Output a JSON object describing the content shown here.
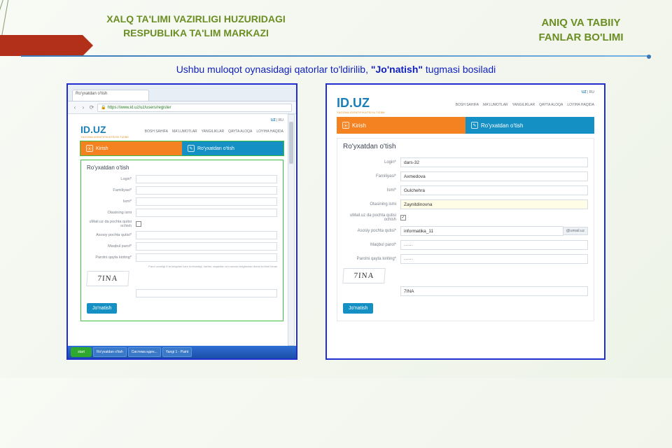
{
  "header": {
    "left_line1": "XALQ TA'LIMI VAZIRLIGI HUZURIDAGI",
    "left_line2": "RESPUBLIKA TA'LIM MARKAZI",
    "right_line1": "ANIQ VA TABIIY",
    "right_line2": "FANLAR BO'LIMI"
  },
  "subtitle": {
    "part1": "Ushbu muloqot oynasidagi qatorlar to'ldirilib, ",
    "part2": "\"Jo'natish\"",
    "part3": "  tugmasi bosiladi"
  },
  "browser": {
    "tab_title": "Ro'yxatdan o'tish",
    "url": "https://www.id.uz/uz/users/register"
  },
  "site": {
    "brand": "ID.UZ",
    "brand_sub": "YAGONA IDENTIFIKATSIYA TIZIMI",
    "lang_active": "UZ",
    "lang_other": "RU",
    "nav": [
      "BOSH SAHIFA",
      "MA'LUMOTLAR",
      "YANGILIKLAR",
      "QAYTA ALOQA",
      "LOYIHA HAQIDA"
    ],
    "tab_login": "Kirish",
    "tab_register": "Ro'yxatdan o'tish",
    "form_title": "Ro'yxatdan o'tish"
  },
  "formA": {
    "labels": {
      "login": "Login*",
      "familiya": "Familiyasi*",
      "ismi": "Ismi*",
      "otasi": "Otasining ismi",
      "umail_chk": "uMail.uz da pochta qutisi ochish",
      "asosiy": "Asosiy pochta qutisi*",
      "parol": "Maqbul parol*",
      "parol2": "Parolni qayta kiriting*"
    },
    "hint": "Parol uzunligi 8 ta belgidan kam bo'lmasligi, harflar, raqamlar va maxsus belgilardan iborat bo'lishi kerak",
    "captcha": "7INA",
    "submit": "Jo'natish"
  },
  "formB": {
    "values": {
      "login": "dars-32",
      "familiya": "Axmedova",
      "ismi": "Gulchehra",
      "otasi": "Zaynitdinovna",
      "umail_checked": "✓",
      "asosiy": "informatika_11",
      "asosiy_suffix": "@umail.uz",
      "parol": "······",
      "parol2": "······",
      "captcha_input": "7INA"
    },
    "captcha": "7INA",
    "submit": "Jo'natish"
  },
  "taskbar": {
    "start": "start",
    "items": [
      "Ro'yxatdan o'tish",
      "Система иден...",
      "Yangi 1 - Paint"
    ]
  }
}
